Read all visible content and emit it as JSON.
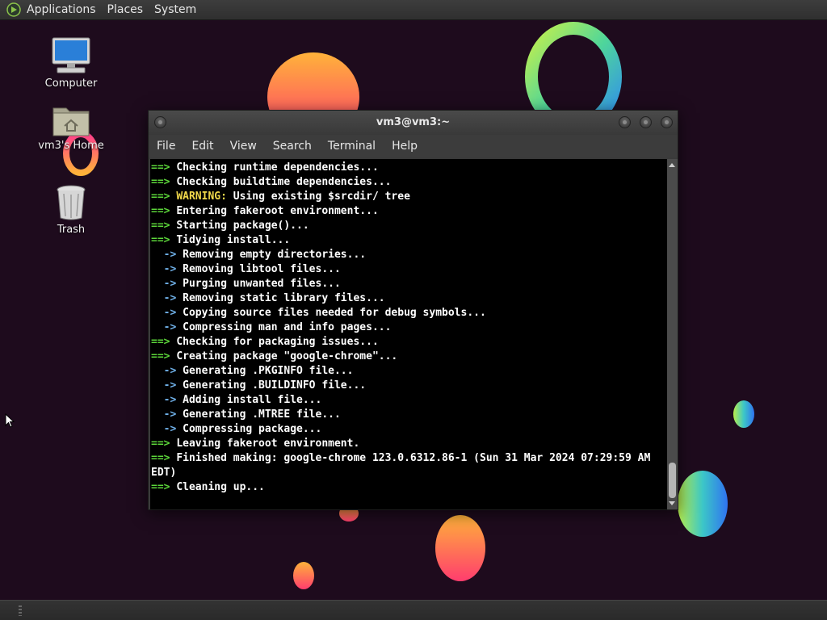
{
  "top_panel": {
    "menus": [
      "Applications",
      "Places",
      "System"
    ]
  },
  "desktop": {
    "icons": [
      {
        "label": "Computer",
        "icon": "computer-icon"
      },
      {
        "label": "vm3's Home",
        "icon": "home-folder-icon"
      },
      {
        "label": "Trash",
        "icon": "trash-icon"
      }
    ]
  },
  "terminal": {
    "title": "vm3@vm3:~",
    "menu": [
      "File",
      "Edit",
      "View",
      "Search",
      "Terminal",
      "Help"
    ],
    "lines": [
      {
        "prefix": "==>",
        "kind": "main",
        "text": "Checking runtime dependencies..."
      },
      {
        "prefix": "==>",
        "kind": "main",
        "text": "Checking buildtime dependencies..."
      },
      {
        "prefix": "==>",
        "kind": "main",
        "warn": "WARNING:",
        "text": "Using existing $srcdir/ tree"
      },
      {
        "prefix": "==>",
        "kind": "main",
        "text": "Entering fakeroot environment..."
      },
      {
        "prefix": "==>",
        "kind": "main",
        "text": "Starting package()..."
      },
      {
        "prefix": "==>",
        "kind": "main",
        "text": "Tidying install..."
      },
      {
        "prefix": "->",
        "kind": "sub",
        "text": "Removing empty directories..."
      },
      {
        "prefix": "->",
        "kind": "sub",
        "text": "Removing libtool files..."
      },
      {
        "prefix": "->",
        "kind": "sub",
        "text": "Purging unwanted files..."
      },
      {
        "prefix": "->",
        "kind": "sub",
        "text": "Removing static library files..."
      },
      {
        "prefix": "->",
        "kind": "sub",
        "text": "Copying source files needed for debug symbols..."
      },
      {
        "prefix": "->",
        "kind": "sub",
        "text": "Compressing man and info pages..."
      },
      {
        "prefix": "==>",
        "kind": "main",
        "text": "Checking for packaging issues..."
      },
      {
        "prefix": "==>",
        "kind": "main",
        "text": "Creating package \"google-chrome\"..."
      },
      {
        "prefix": "->",
        "kind": "sub",
        "text": "Generating .PKGINFO file..."
      },
      {
        "prefix": "->",
        "kind": "sub",
        "text": "Generating .BUILDINFO file..."
      },
      {
        "prefix": "->",
        "kind": "sub",
        "text": "Adding install file..."
      },
      {
        "prefix": "->",
        "kind": "sub",
        "text": "Generating .MTREE file..."
      },
      {
        "prefix": "->",
        "kind": "sub",
        "text": "Compressing package..."
      },
      {
        "prefix": "==>",
        "kind": "main",
        "text": "Leaving fakeroot environment."
      },
      {
        "prefix": "==>",
        "kind": "main",
        "text": "Finished making: google-chrome 123.0.6312.86-1 (Sun 31 Mar 2024 07:29:59 AM"
      },
      {
        "prefix": "",
        "kind": "cont",
        "text": "EDT)"
      },
      {
        "prefix": "==>",
        "kind": "main",
        "text": "Cleaning up..."
      }
    ]
  },
  "colors": {
    "prompt_arrow": "#5cd63a",
    "sub_arrow": "#6fb0e8",
    "warning": "#f2d94b",
    "terminal_bg": "#000000"
  }
}
